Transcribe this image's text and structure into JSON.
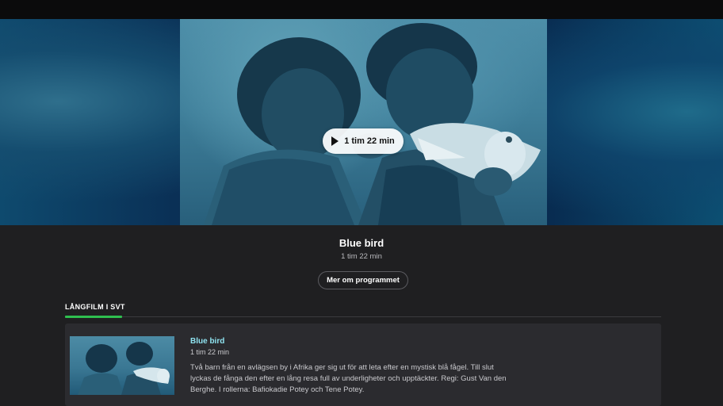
{
  "hero": {
    "play_label": "1 tim 22 min",
    "image_alt": "Two children holding a white bird"
  },
  "program": {
    "title": "Blue bird",
    "duration": "1 tim 22 min",
    "more_button": "Mer om programmet"
  },
  "section": {
    "label": "LÅNGFILM I SVT",
    "accent_color": "#2fbf4f"
  },
  "card": {
    "title": "Blue bird",
    "duration": "1 tim 22 min",
    "description": "Två barn från en avlägsen by i Afrika ger sig ut för att leta efter en mystisk blå fågel. Till slut lyckas de fånga den efter en lång resa full av underligheter och upptäckter. Regi: Gust Van den Berghe. I rollerna: Bafiokadie Potey och Tene Potey.",
    "title_color": "#8fe3f0"
  },
  "icons": {
    "play": "play-icon"
  }
}
